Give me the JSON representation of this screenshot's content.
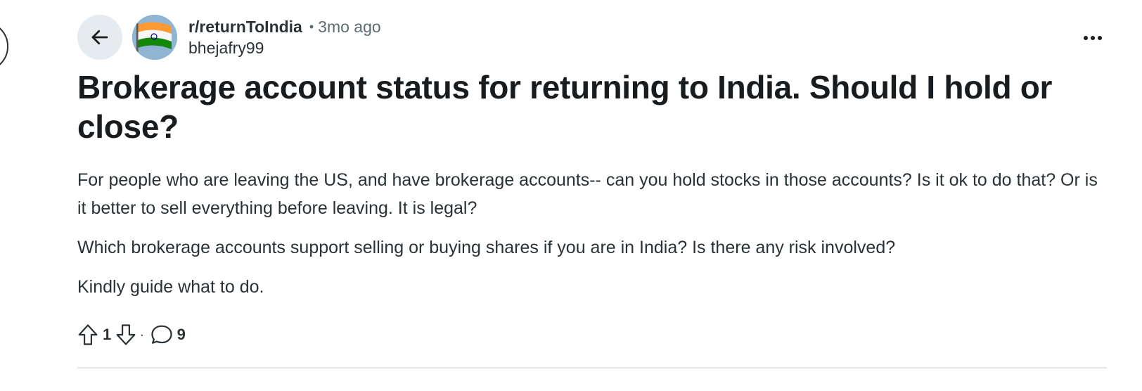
{
  "post": {
    "subreddit": "r/returnToIndia",
    "separator": "•",
    "time": "3mo ago",
    "author": "bhejafry99",
    "title": "Brokerage account status for returning to India. Should I hold or close?",
    "body": [
      "For people who are leaving the US, and have brokerage accounts-- can you hold stocks in those accounts? Is it ok to do that? Or is it better to sell everything before leaving. It is legal?",
      "Which brokerage accounts support selling or buying shares if you are in India? Is there any risk involved?",
      "Kindly guide what to do."
    ],
    "upvotes": "1",
    "action_separator": "·",
    "comments": "9"
  },
  "icons": {
    "back": "arrow-left-icon",
    "more": "more-horizontal-icon",
    "upvote": "arrow-up-outline-icon",
    "downvote": "arrow-down-outline-icon",
    "comment": "speech-bubble-icon"
  },
  "colors": {
    "back_button_bg": "#e5ebee",
    "text_primary": "#181c1f",
    "text_secondary": "#5c6c74",
    "flag_saffron": "#ff9933",
    "flag_green": "#138808",
    "chakra": "#000080"
  }
}
